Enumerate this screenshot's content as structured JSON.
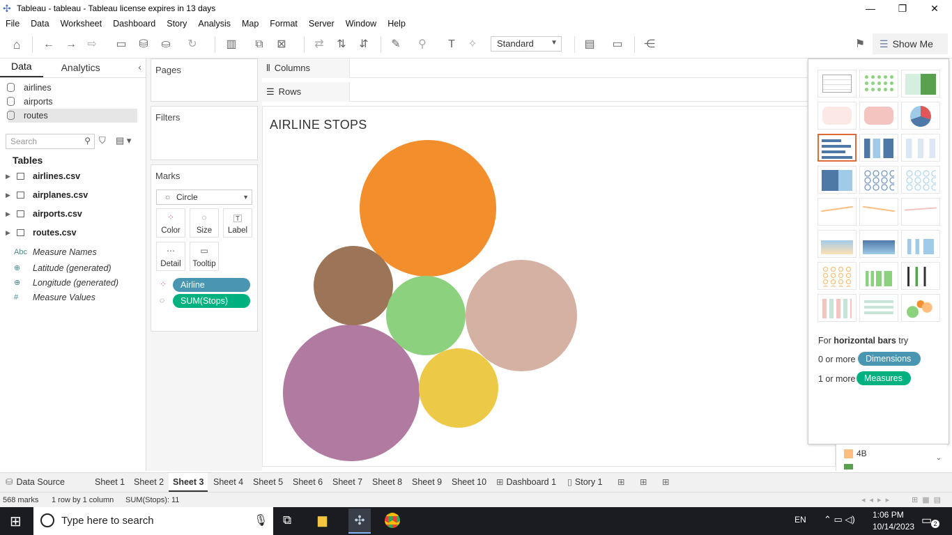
{
  "window": {
    "title": "Tableau - tableau - Tableau license expires in 13 days"
  },
  "menu": [
    "File",
    "Data",
    "Worksheet",
    "Dashboard",
    "Story",
    "Analysis",
    "Map",
    "Format",
    "Server",
    "Window",
    "Help"
  ],
  "toolbar": {
    "fit_mode": "Standard",
    "show_me_label": "Show Me"
  },
  "data_pane": {
    "tabs": {
      "data": "Data",
      "analytics": "Analytics"
    },
    "datasources": [
      "airlines",
      "airports",
      "routes"
    ],
    "search_placeholder": "Search",
    "tables_header": "Tables",
    "tables": [
      "airlines.csv",
      "airplanes.csv",
      "airports.csv",
      "routes.csv"
    ],
    "measure_fields": [
      {
        "icon": "Abc",
        "label": "Measure Names"
      },
      {
        "icon": "globe",
        "label": "Latitude (generated)"
      },
      {
        "icon": "globe",
        "label": "Longitude (generated)"
      },
      {
        "icon": "#",
        "label": "Measure Values"
      }
    ]
  },
  "cards": {
    "pages": "Pages",
    "filters": "Filters",
    "marks": "Marks",
    "mark_type": "Circle",
    "buttons": {
      "color": "Color",
      "size": "Size",
      "label": "Label",
      "detail": "Detail",
      "tooltip": "Tooltip"
    },
    "pills": {
      "airline": "Airline",
      "stops": "SUM(Stops)"
    }
  },
  "shelves": {
    "columns": "Columns",
    "rows": "Rows"
  },
  "view": {
    "title": "AIRLINE STOPS"
  },
  "chart_data": {
    "type": "packed-bubble",
    "title": "AIRLINE STOPS",
    "encoding": {
      "color": "Airline",
      "size": "SUM(Stops)"
    },
    "bubbles": [
      {
        "color": "#f28e2b",
        "rel_size": 1.0
      },
      {
        "color": "#b07aa1",
        "rel_size": 1.0
      },
      {
        "color": "#d4b1a2",
        "rel_size": 0.82
      },
      {
        "color": "#9c7458",
        "rel_size": 0.58
      },
      {
        "color": "#8cd17d",
        "rel_size": 0.58
      },
      {
        "color": "#edc948",
        "rel_size": 0.58
      }
    ]
  },
  "show_me": {
    "hint_prefix": "For ",
    "hint_bold": "horizontal bars",
    "hint_suffix": " try",
    "dims_prefix": "0 or more",
    "dims_label": "Dimensions",
    "meas_prefix": "1 or more",
    "meas_label": "Measures",
    "selected": "horizontal bars"
  },
  "legend": {
    "item": "4B"
  },
  "sheets": {
    "datasource": "Data Source",
    "tabs": [
      "Sheet 1",
      "Sheet 2",
      "Sheet 3",
      "Sheet 4",
      "Sheet 5",
      "Sheet 6",
      "Sheet 7",
      "Sheet 8",
      "Sheet 9",
      "Sheet 10"
    ],
    "active": "Sheet 3",
    "dashboard": "Dashboard 1",
    "story": "Story 1"
  },
  "status": {
    "marks": "568 marks",
    "grid": "1 row by 1 column",
    "sum": "SUM(Stops): 11"
  },
  "taskbar": {
    "search_placeholder": "Type here to search",
    "lang": "EN",
    "time": "1:06 PM",
    "date": "10/14/2023",
    "notif_count": "2"
  },
  "colors": {
    "dims_pill": "#4996b2",
    "meas_pill": "#00b180",
    "accent_selected": "#e06a3a"
  }
}
